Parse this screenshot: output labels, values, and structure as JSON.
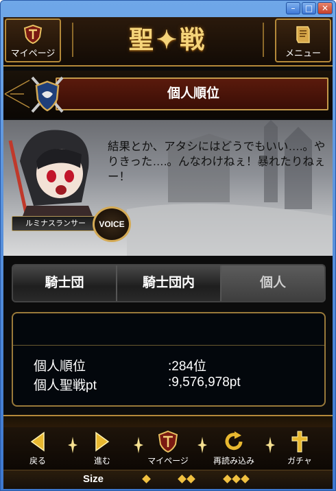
{
  "window": {
    "min": "–",
    "max": "□",
    "close": "✕"
  },
  "header": {
    "mypage_label": "マイページ",
    "logo_text": "聖✦戦",
    "menu_label": "メニュー"
  },
  "section": {
    "title": "個人順位"
  },
  "character": {
    "dialogue": "結果とか、アタシにはどうでもいい….。やりきった….。んなわけねぇ！暴れたりねぇー！",
    "name": "ルミナスランサー",
    "voice_label": "VOICE"
  },
  "tabs": [
    {
      "label": "騎士団"
    },
    {
      "label": "騎士団内"
    },
    {
      "label": "個人"
    }
  ],
  "stats": {
    "rank_label": "個人順位",
    "rank_value": ":284位",
    "points_label": "個人聖戦pt",
    "points_value": ":9,576,978pt"
  },
  "footer": {
    "back_label": "戻る",
    "forward_label": "進む",
    "mypage_label": "マイページ",
    "reload_label": "再読み込み",
    "gacha_label": "ガチャ",
    "size_label": "Size"
  },
  "colors": {
    "gold": "#b58a3a",
    "accent_red": "#5a1a0c"
  }
}
